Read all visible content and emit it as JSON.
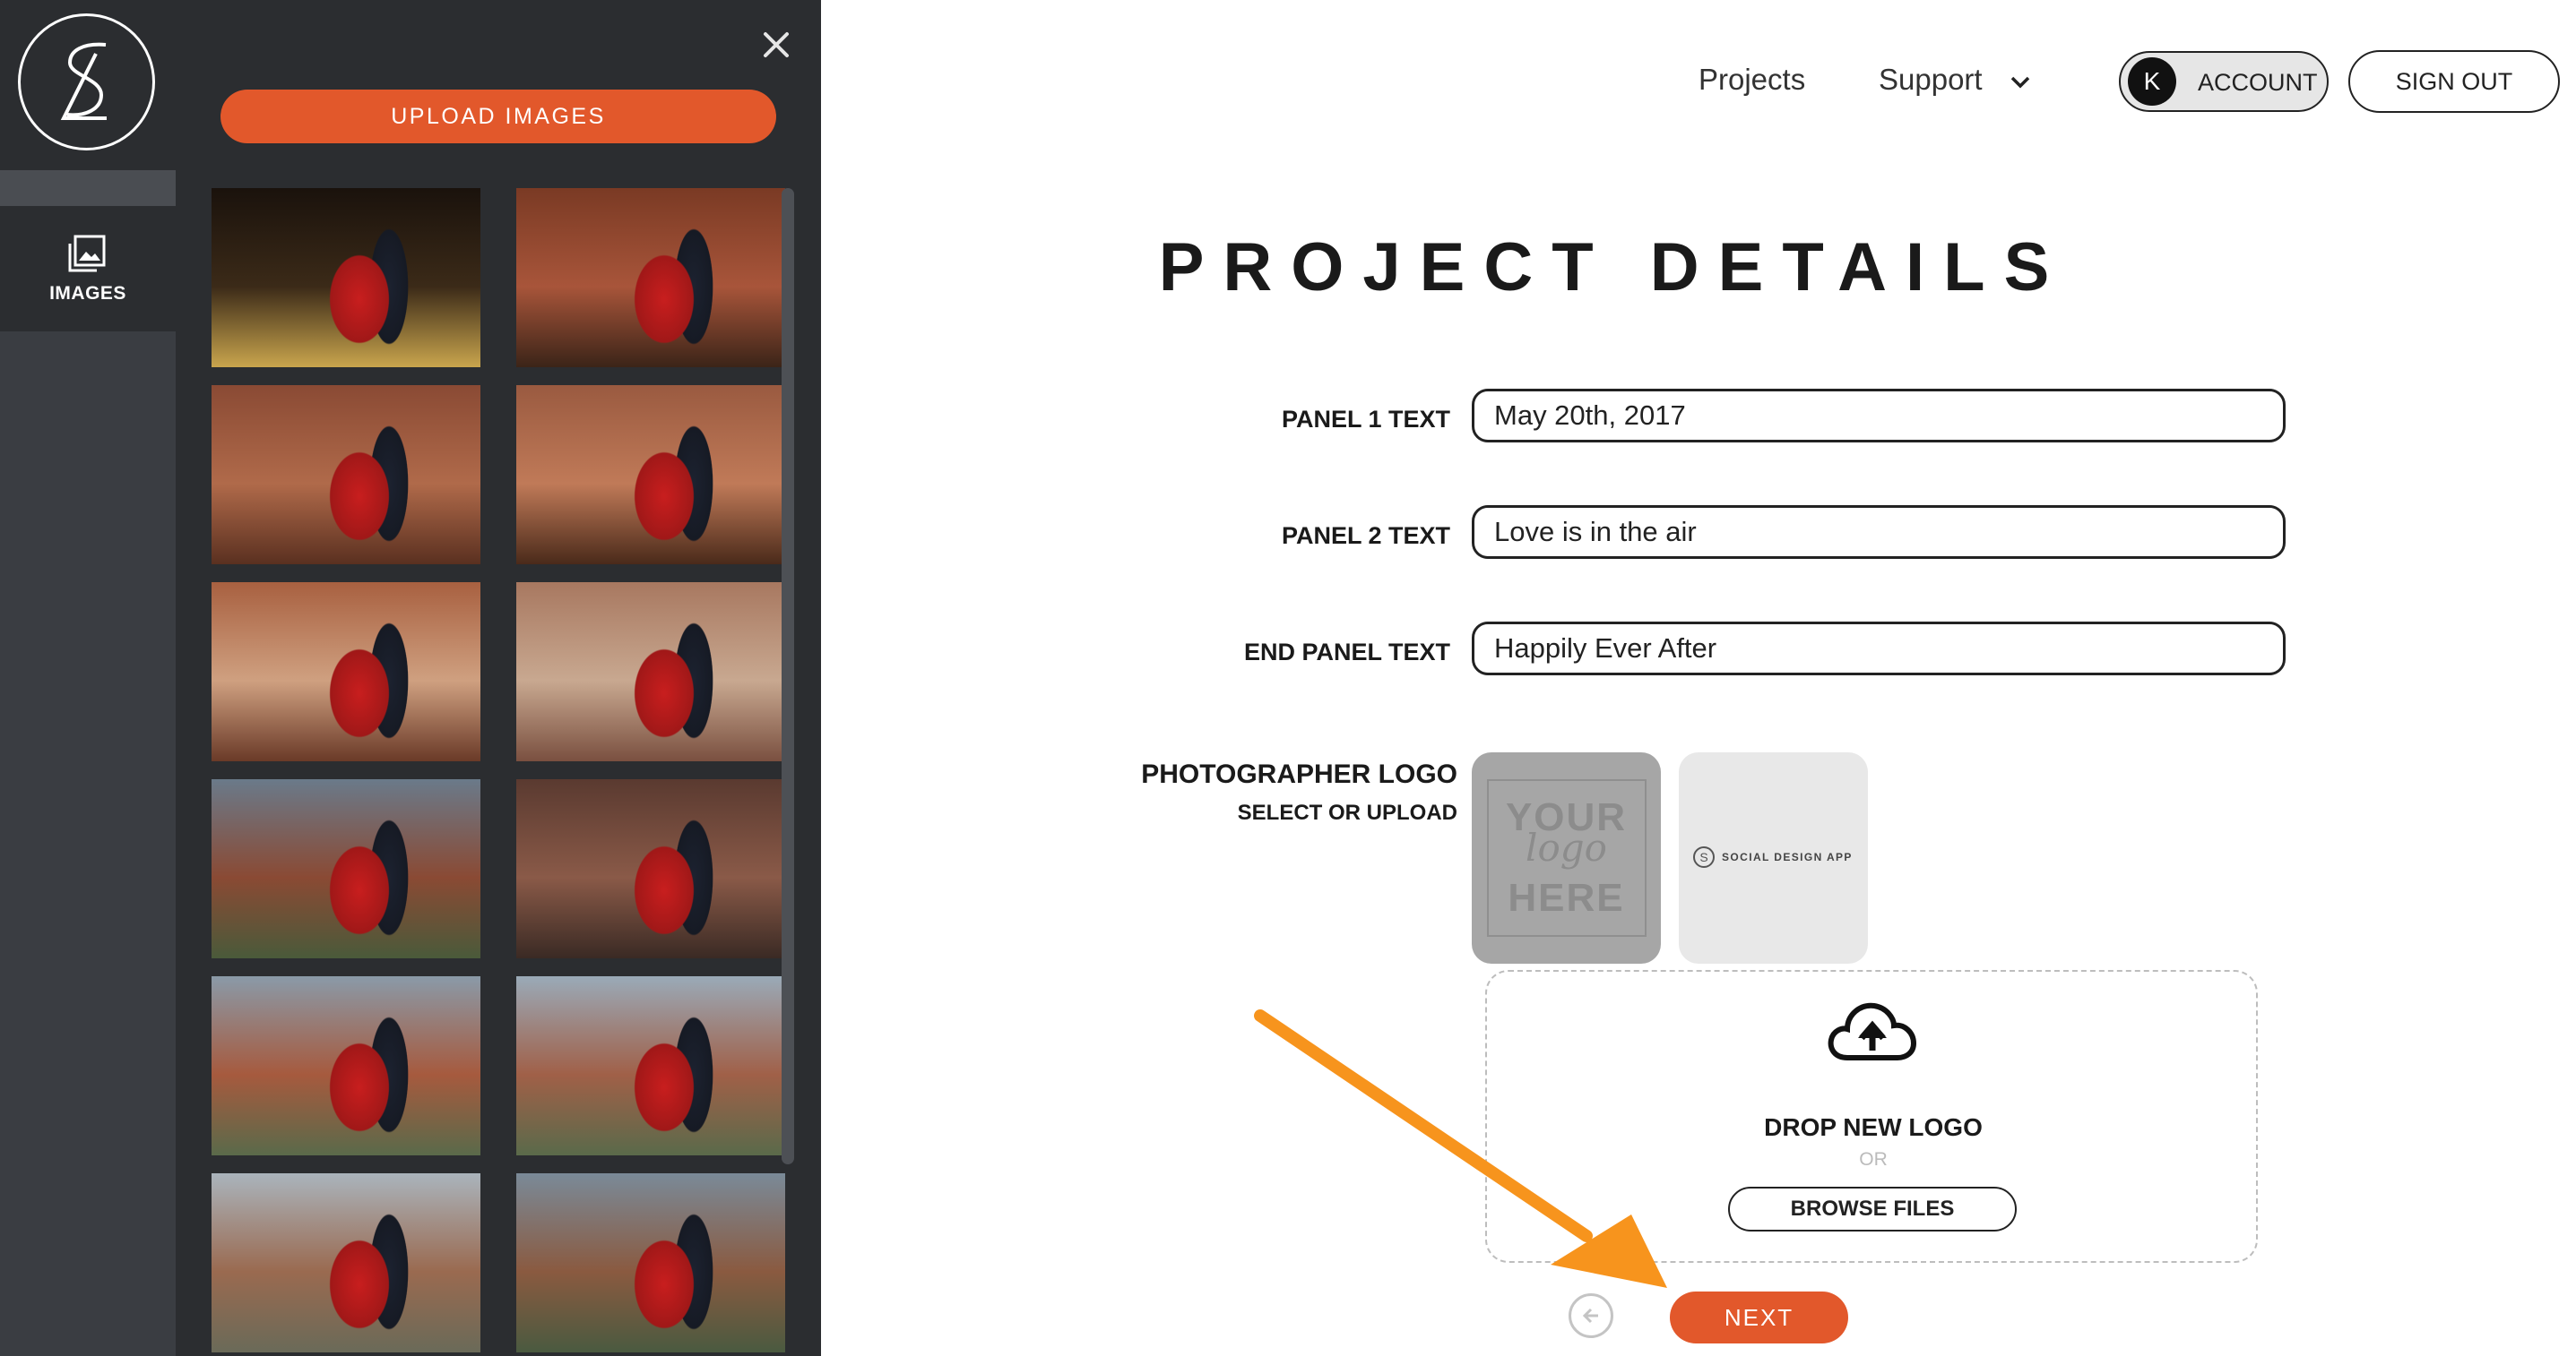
{
  "sidebar": {
    "tab_images_label": "IMAGES"
  },
  "image_panel": {
    "upload_label": "UPLOAD IMAGES",
    "thumbnails": [
      {
        "alt": "couple embracing at sunset in brush"
      },
      {
        "alt": "couple hugging on red hillside"
      },
      {
        "alt": "couple close embrace red slope"
      },
      {
        "alt": "couple walking hand in hand"
      },
      {
        "alt": "couple walking on painted hills"
      },
      {
        "alt": "couple kissing on hillside"
      },
      {
        "alt": "couple embrace with trees"
      },
      {
        "alt": "couple close up embrace"
      },
      {
        "alt": "couple laughing painted hills"
      },
      {
        "alt": "couple standing painted hills"
      },
      {
        "alt": "couple on road hills"
      },
      {
        "alt": "couple embrace hills dusk"
      }
    ]
  },
  "header": {
    "projects": "Projects",
    "support": "Support",
    "account_initial": "K",
    "account": "ACCOUNT",
    "signout": "SIGN OUT"
  },
  "form": {
    "title": "PROJECT DETAILS",
    "panel1_label": "PANEL 1 TEXT",
    "panel1_value": "May 20th, 2017",
    "panel2_label": "PANEL 2 TEXT",
    "panel2_value": "Love is in the air",
    "end_label": "END PANEL TEXT",
    "end_value": "Happily Ever After",
    "logo_label": "PHOTOGRAPHER LOGO",
    "logo_sub": "SELECT OR UPLOAD",
    "logo_placeholder": {
      "line1": "YOUR",
      "line2": "logo",
      "line3": "HERE"
    },
    "logo_brand": "SOCIAL DESIGN APP",
    "drop_title": "DROP NEW LOGO",
    "drop_or": "OR",
    "browse": "BROWSE FILES",
    "next": "NEXT"
  },
  "colors": {
    "accent": "#e2582b",
    "panel_bg": "#2b2d30",
    "rail_bg": "#3a3d42",
    "annotation_arrow": "#f7941d"
  }
}
